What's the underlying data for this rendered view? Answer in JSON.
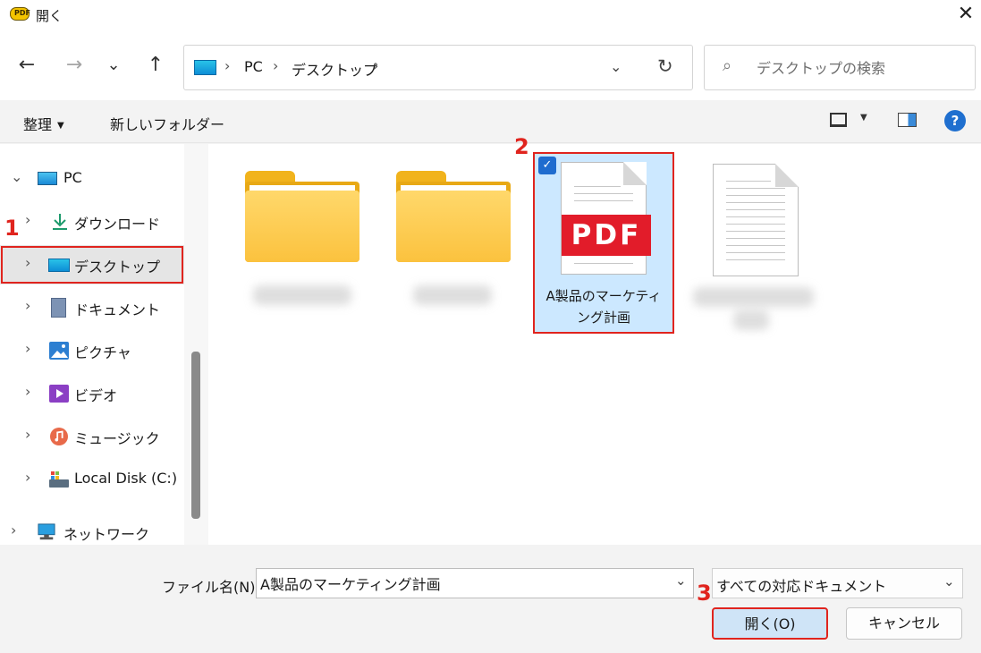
{
  "window": {
    "title": "開く",
    "app_icon_text": "PDF",
    "close_glyph": "✕"
  },
  "nav": {
    "back": "←",
    "forward": "→",
    "recent": "⌄",
    "up": "↑",
    "breadcrumbs": [
      "PC",
      "デスクトップ"
    ],
    "sep": "›",
    "dropdown": "⌄",
    "refresh": "↻",
    "search_placeholder": "デスクトップの検索",
    "search_icon": "⌕"
  },
  "toolbar": {
    "organize_label": "整理",
    "organize_caret": "▼",
    "new_folder_label": "新しいフォルダー",
    "view_caret": "▼",
    "help": "?"
  },
  "sidebar": {
    "items": [
      {
        "label": "PC",
        "icon": "monitor-icon",
        "expanded": true
      },
      {
        "label": "ダウンロード",
        "icon": "download-icon"
      },
      {
        "label": "デスクトップ",
        "icon": "desktop-icon",
        "selected": true
      },
      {
        "label": "ドキュメント",
        "icon": "document-icon"
      },
      {
        "label": "ピクチャ",
        "icon": "pictures-icon"
      },
      {
        "label": "ビデオ",
        "icon": "video-icon"
      },
      {
        "label": "ミュージック",
        "icon": "music-icon"
      },
      {
        "label": "Local Disk (C:)",
        "icon": "disk-icon"
      },
      {
        "label": "ネットワーク",
        "icon": "network-icon"
      }
    ],
    "chevron_right": "›",
    "chevron_down": "⌄"
  },
  "files": [
    {
      "type": "folder"
    },
    {
      "type": "folder"
    },
    {
      "type": "pdf",
      "name": "A製品のマーケティング計画",
      "name_line1": "A製品のマーケティ",
      "name_line2": "ング計画",
      "badge": "PDF",
      "selected": true
    },
    {
      "type": "text"
    }
  ],
  "steps": {
    "one": "1",
    "two": "2",
    "three": "3"
  },
  "footer": {
    "filename_label": "ファイル名(N):",
    "filename_value": "A製品のマーケティング計画",
    "filter_value": "すべての対応ドキュメント",
    "dropdown": "⌄",
    "open_label": "開く(O)",
    "cancel_label": "キャンセル"
  }
}
